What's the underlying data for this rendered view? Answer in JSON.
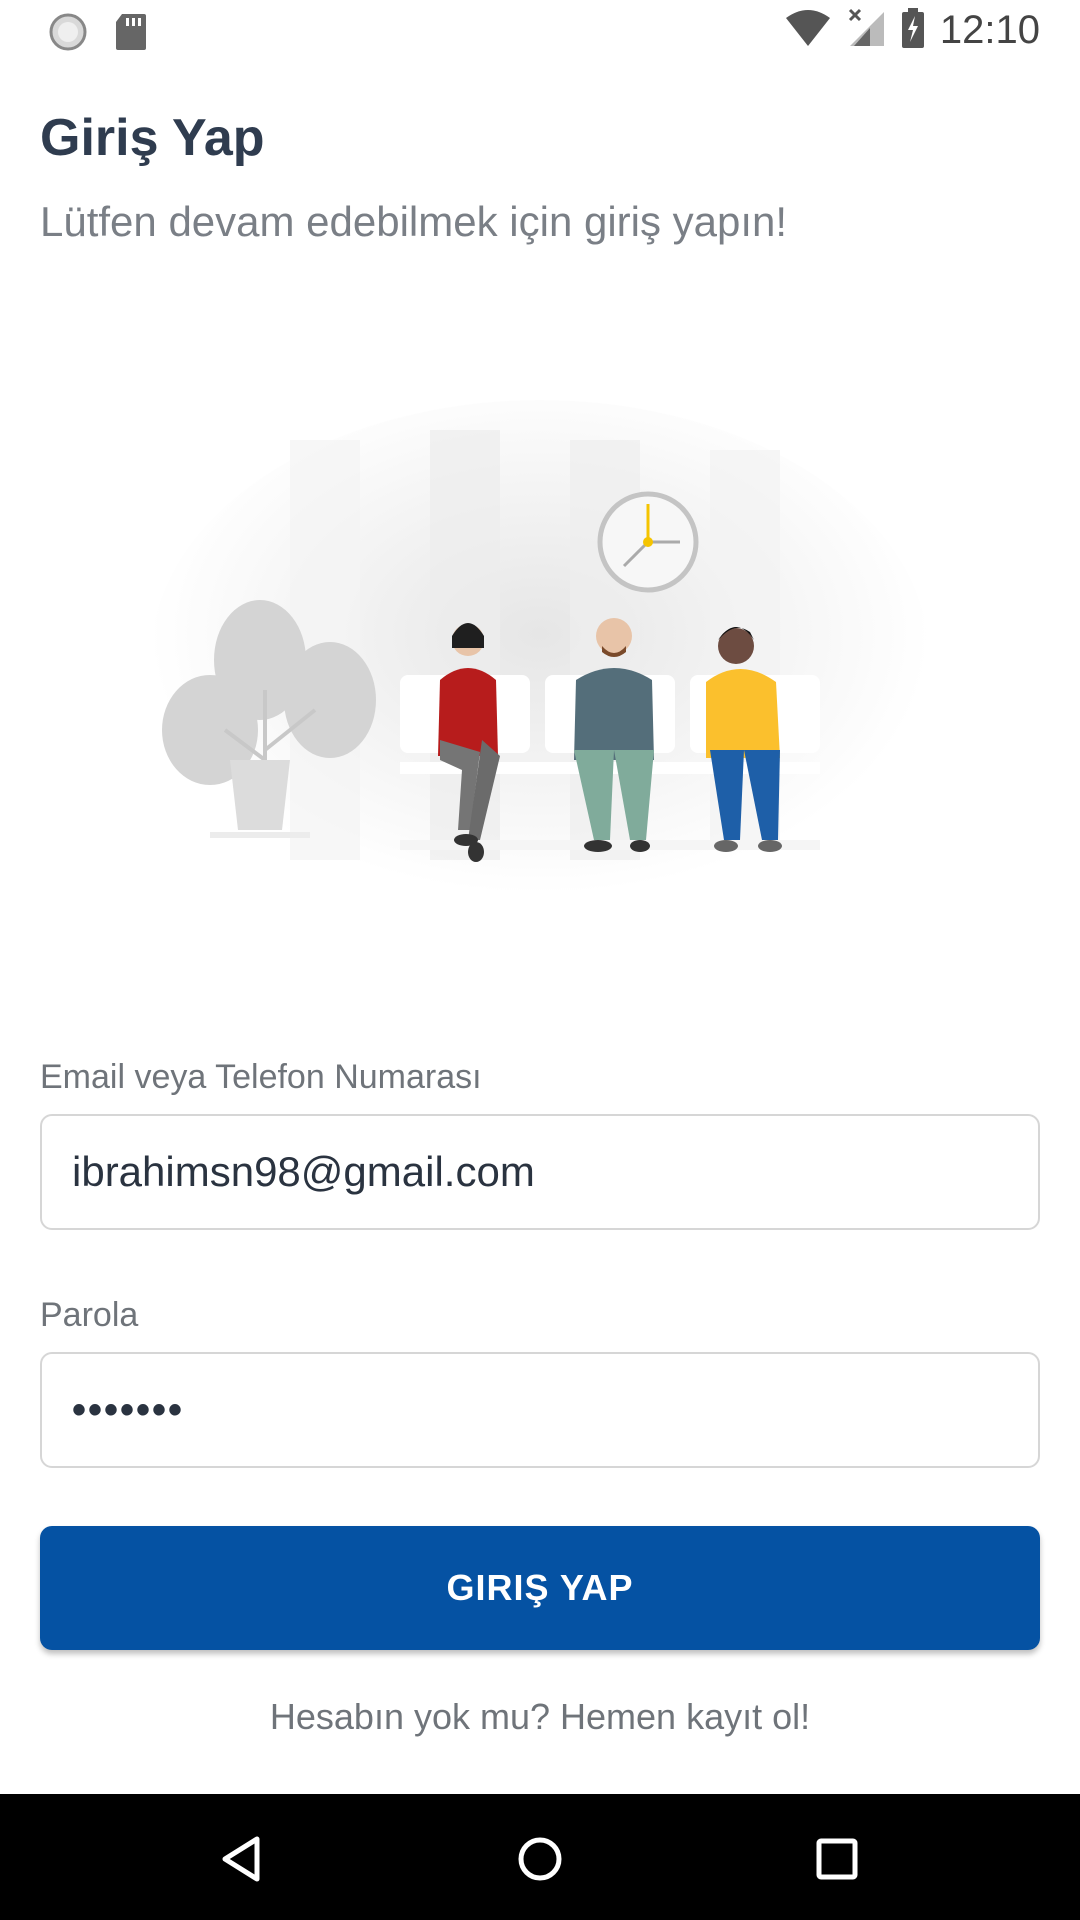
{
  "status_bar": {
    "time": "12:10",
    "left_icons": [
      "sync-circle-icon",
      "sd-card-icon"
    ],
    "right_icons": [
      "wifi-icon",
      "cell-signal-no-data-icon",
      "battery-charging-icon"
    ]
  },
  "header": {
    "title": "Giriş Yap",
    "subtitle": "Lütfen devam edebilmek için giriş yapın!"
  },
  "illustration": {
    "icon": "waiting-room-illustration"
  },
  "form": {
    "email_label": "Email veya Telefon Numarası",
    "email_value": "ibrahimsn98@gmail.com",
    "password_label": "Parola",
    "password_value": "•••••••",
    "submit_label": "GIRIŞ YAP",
    "register_link": "Hesabın yok mu? Hemen kayıt ol!"
  },
  "colors": {
    "primary": "#0552a3",
    "title": "#2f3c4f",
    "muted": "#7a7f86"
  },
  "nav_bar": {
    "buttons": [
      "back-icon",
      "home-icon",
      "recents-icon"
    ]
  }
}
